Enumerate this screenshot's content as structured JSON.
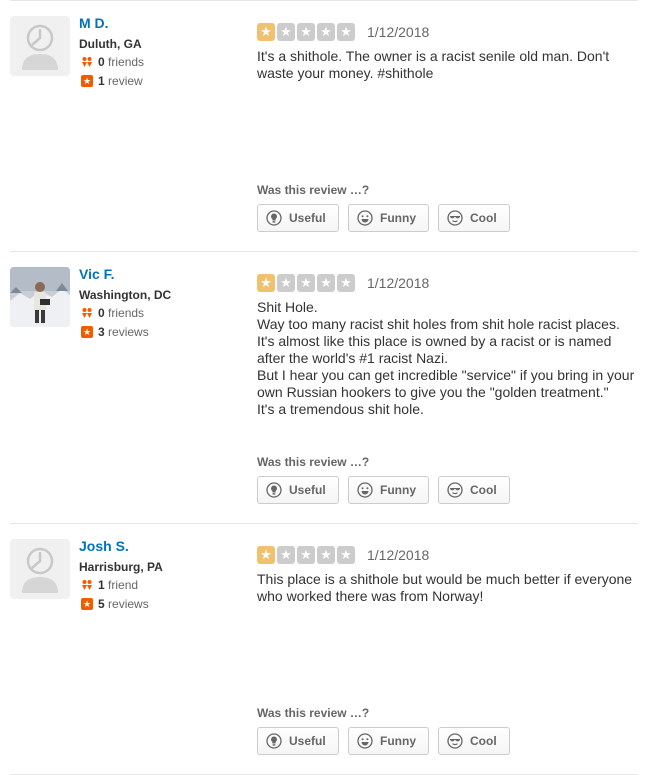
{
  "reviews": [
    {
      "user": {
        "name": "M D.",
        "location": "Duluth, GA",
        "friends": "0",
        "friends_label": "friends",
        "reviews": "1",
        "reviews_label": "review",
        "avatar": "default-avatar-icon"
      },
      "rating": 1,
      "date": "1/12/2018",
      "text": "It's a shithole. The owner is a racist senile old man. Don't waste your money. #shithole",
      "prompt": "Was this review …?",
      "buttons": {
        "useful": "Useful",
        "funny": "Funny",
        "cool": "Cool"
      }
    },
    {
      "user": {
        "name": "Vic F.",
        "location": "Washington, DC",
        "friends": "0",
        "friends_label": "friends",
        "reviews": "3",
        "reviews_label": "reviews",
        "avatar": "user-photo"
      },
      "rating": 1,
      "date": "1/12/2018",
      "text": "Shit Hole.\nWay too many racist shit holes from shit hole racist places.  It's almost like this place is owned by a racist or is named after the world's #1 racist Nazi.\nBut I hear you can get incredible \"service\" if you bring in your own Russian hookers to give you the \"golden treatment.\"\nIt's a tremendous shit hole.",
      "prompt": "Was this review …?",
      "buttons": {
        "useful": "Useful",
        "funny": "Funny",
        "cool": "Cool"
      }
    },
    {
      "user": {
        "name": "Josh S.",
        "location": "Harrisburg, PA",
        "friends": "1",
        "friends_label": "friend",
        "reviews": "5",
        "reviews_label": "reviews",
        "avatar": "default-avatar-icon"
      },
      "rating": 1,
      "date": "1/12/2018",
      "text": "This place is a shithole but would be much better if everyone who worked there was from Norway!",
      "prompt": "Was this review …?",
      "buttons": {
        "useful": "Useful",
        "funny": "Funny",
        "cool": "Cool"
      }
    }
  ],
  "colors": {
    "username": "#0073bb",
    "star_on": "#f0c26f",
    "star_off": "#cccccc",
    "friends_icon": "#f15c00",
    "review_icon": "#f15c00"
  }
}
